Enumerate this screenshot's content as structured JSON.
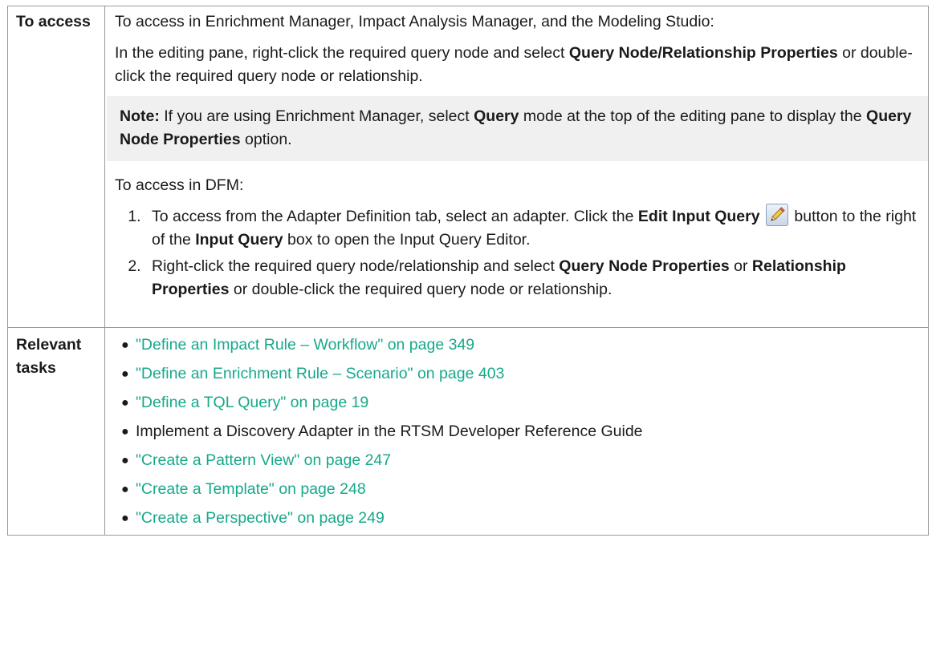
{
  "access": {
    "label": "To access",
    "intro": "To access in Enrichment Manager, Impact Analysis Manager, and the Modeling Studio:",
    "para1_pre": "In the editing pane, right-click the required query node and select ",
    "para1_bold": "Query Node/Relationship Properties",
    "para1_post": " or double-click the required query node or relationship.",
    "note": {
      "label": "Note:",
      "text1": " If you are using Enrichment Manager, select ",
      "bold1": "Query",
      "text2": " mode at the top of the editing pane to display the ",
      "bold2": "Query Node Properties",
      "text3": " option."
    },
    "dfm_intro": "To access in DFM:",
    "steps": [
      {
        "t1": "To access from the Adapter Definition tab, select an adapter. Click the ",
        "b1": "Edit Input Query",
        "icon": "pencil-icon",
        "t2": " button to the right of the ",
        "b2": "Input Query",
        "t3": " box to open the Input Query Editor."
      },
      {
        "t1": "Right-click the required query node/relationship and select ",
        "b1": "Query Node Properties",
        "t2": " or ",
        "b2": "Relationship Properties",
        "t3": " or double-click the required query node or relationship."
      }
    ]
  },
  "tasks": {
    "label": "Relevant tasks",
    "items": [
      {
        "text": "\"Define an Impact Rule – Workflow\" on page 349",
        "link": true
      },
      {
        "text": "\"Define an Enrichment Rule – Scenario\" on page 403",
        "link": true
      },
      {
        "text": "\"Define a TQL Query\" on page 19",
        "link": true
      },
      {
        "text": "Implement a Discovery Adapter in the RTSM Developer Reference Guide",
        "link": false
      },
      {
        "text": "\"Create a Pattern View\" on page 247",
        "link": true
      },
      {
        "text": "\"Create a Template\" on page 248",
        "link": true
      },
      {
        "text": "\"Create a Perspective\" on page 249",
        "link": true
      }
    ]
  },
  "colors": {
    "link": "#17a98a",
    "note_bg": "#f0f0f0",
    "border": "#9a9a9a"
  }
}
